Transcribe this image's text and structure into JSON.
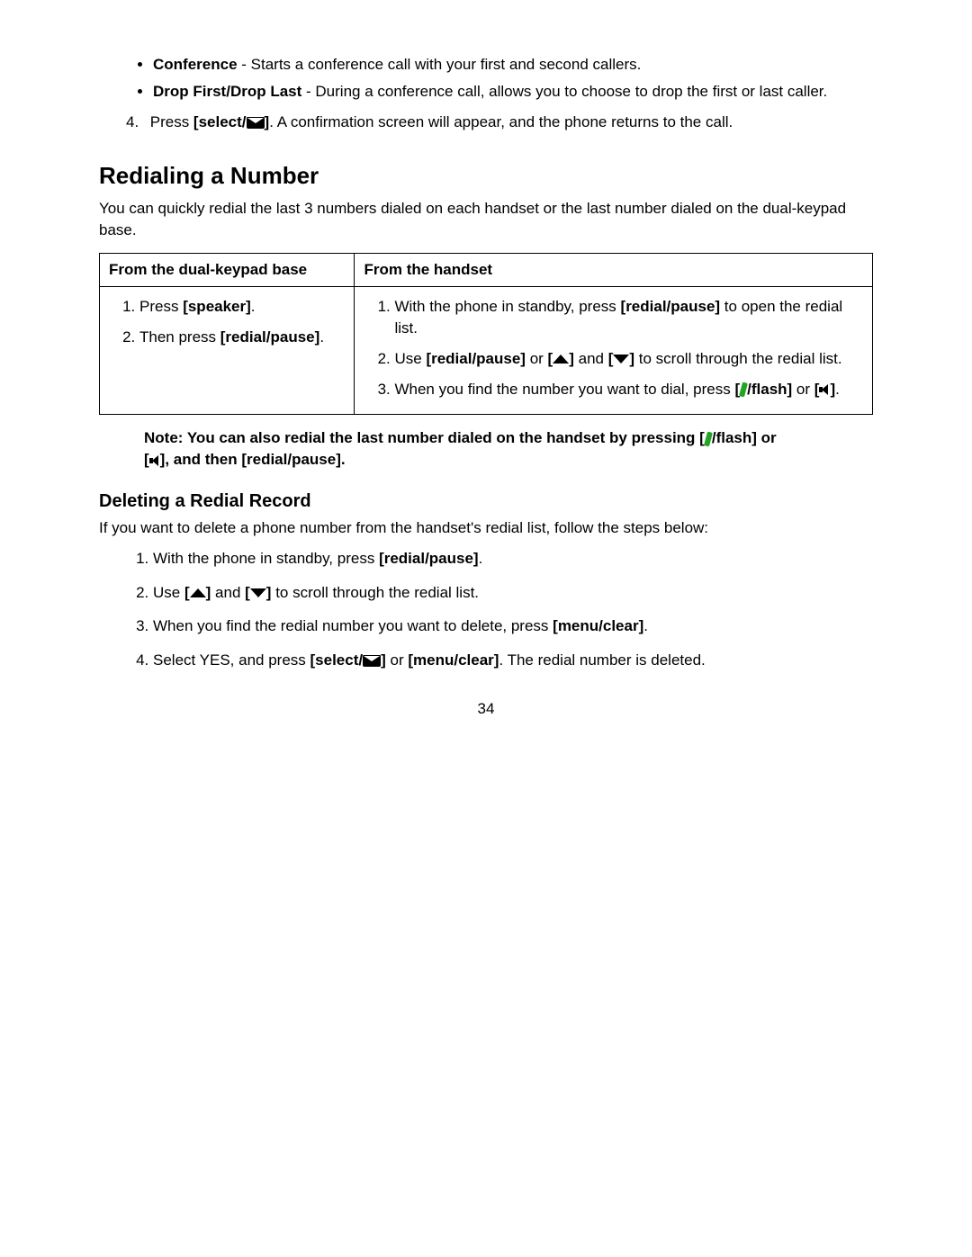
{
  "bullets": [
    {
      "term": "Conference",
      "desc": " - Starts a conference call with your first and second callers."
    },
    {
      "term": "Drop First/Drop Last",
      "desc": " - During a conference call, allows you to choose to drop the first or last caller."
    }
  ],
  "step4": {
    "num": "4.",
    "pre": "Press ",
    "key": "[select/",
    "keyClose": "]",
    "post": ". A confirmation screen will appear, and the phone returns to the call."
  },
  "heading1": "Redialing a Number",
  "intro1": "You can quickly redial the last 3 numbers dialed on each handset or the last number dialed on the dual-keypad base.",
  "table": {
    "h1": "From the dual-keypad base",
    "h2": "From the handset",
    "left": {
      "l1a": "Press ",
      "l1b": "[speaker]",
      "l1c": ".",
      "l2a": "Then press ",
      "l2b": "[redial/pause]",
      "l2c": "."
    },
    "right": {
      "r1a": "With the phone in standby, press ",
      "r1b": "[redial/pause]",
      "r1c": " to open the redial list.",
      "r2a": "Use ",
      "r2b": "[redial/pause]",
      "r2c": " or ",
      "r2d": " and ",
      "r2e": " to scroll through the redial list.",
      "r3a": "When you find the number you want to dial, press ",
      "r3b": "flash]",
      "r3c": " or ",
      "r3d": "."
    }
  },
  "note": {
    "n1": "Note: You can also redial the last number dialed on the handset by pressing [",
    "n2": "flash]  or",
    "n3": "[",
    "n4": "],  and then [redial/pause]."
  },
  "heading2": "Deleting a Redial Record",
  "intro2": "If you want to delete a phone number from the handset's redial list, follow the steps below:",
  "delete": {
    "d1a": "With the phone in standby, press ",
    "d1b": "[redial/pause]",
    "d1c": ".",
    "d2a": "Use ",
    "d2b": " and ",
    "d2c": " to scroll through the redial list.",
    "d3a": "When you find the redial number you want to delete, press ",
    "d3b": "[menu/clear]",
    "d3c": ".",
    "d4a": "Select YES, and press ",
    "d4b": "[select/",
    "d4c": "]",
    "d4d": " or ",
    "d4e": "[menu/clear]",
    "d4f": ". The redial number is deleted."
  },
  "pagenum": "34"
}
